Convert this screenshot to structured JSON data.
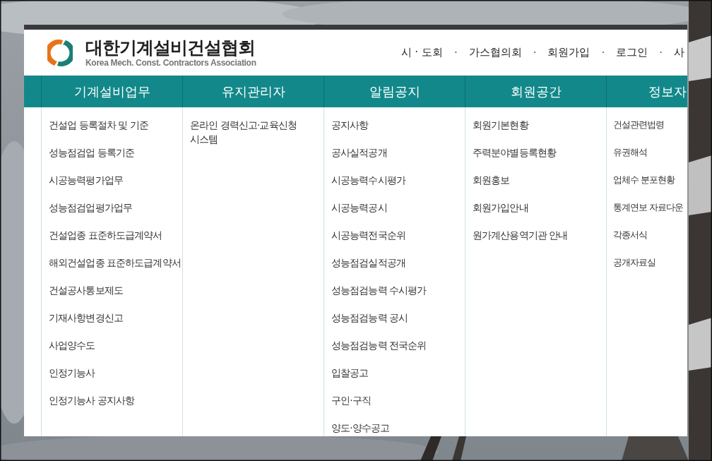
{
  "header": {
    "logo_title": "대한기계설비건설협회",
    "logo_subtitle": "Korea Mech. Const. Contractors Association"
  },
  "nav": [
    {
      "kind": "link",
      "label": "시 · 도회"
    },
    {
      "kind": "separator",
      "label": "·"
    },
    {
      "kind": "link",
      "label": "가스협의회"
    },
    {
      "kind": "separator",
      "label": "·"
    },
    {
      "kind": "link",
      "label": "회원가입"
    },
    {
      "kind": "separator",
      "label": "·"
    },
    {
      "kind": "link",
      "label": "로그인"
    },
    {
      "kind": "separator",
      "label": "·"
    },
    {
      "kind": "link",
      "label": "사"
    }
  ],
  "menu": [
    {
      "title": "기계설비업무",
      "items": [
        "건설업 등록절차 및 기준",
        "성능점검업 등록기준",
        "시공능력평가업무",
        "성능점검업평가업무",
        "건설업종 표준하도급계약서",
        "해외건설업종 표준하도급계약서",
        "건설공사통보제도",
        "기재사항변경신고",
        "사업양수도",
        "인정기능사",
        "인정기능사 공지사항"
      ]
    },
    {
      "title": "유지관리자",
      "items": [
        "온라인 경력신고·교육신청 시스템"
      ]
    },
    {
      "title": "알림공지",
      "items": [
        "공지사항",
        "공사실적공개",
        "시공능력수시평가",
        "시공능력공시",
        "시공능력전국순위",
        "성능점검실적공개",
        "성능점검능력 수시평가",
        "성능점검능력 공시",
        "성능점검능력 전국순위",
        "입찰공고",
        "구인·구직",
        "양도·양수공고"
      ]
    },
    {
      "title": "회원공간",
      "items": [
        "회원기본현황",
        "주력분야별등록현황",
        "회원홍보",
        "회원가입안내",
        "원가계산용역기관 안내"
      ]
    },
    {
      "title": "정보자",
      "items": [
        "건설관련법령",
        "유권해석",
        "업체수 분포현황",
        "통계연보 자료다운",
        "각종서식",
        "공개자료실"
      ]
    }
  ]
}
